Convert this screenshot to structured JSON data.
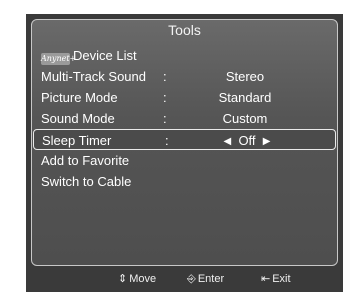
{
  "menu": {
    "title": "Tools",
    "logo_text": "Anynet+",
    "items": [
      {
        "label": "Device List"
      },
      {
        "label": "Multi-Track Sound",
        "separator": ":",
        "value": "Stereo"
      },
      {
        "label": "Picture Mode",
        "separator": ":",
        "value": "Standard"
      },
      {
        "label": "Sound Mode",
        "separator": ":",
        "value": "Custom"
      },
      {
        "label": "Sleep Timer",
        "separator": ":",
        "value": "Off",
        "selected": true
      },
      {
        "label": "Add to Favorite"
      },
      {
        "label": "Switch to Cable"
      }
    ]
  },
  "footer": {
    "move_label": "Move",
    "enter_label": "Enter",
    "exit_label": "Exit"
  },
  "icons": {
    "left_arrow": "left-triangle-icon",
    "right_arrow": "right-triangle-icon",
    "move": "up-down-icon",
    "enter": "enter-icon",
    "exit": "exit-icon"
  },
  "colors": {
    "panel_bg": "#585858",
    "outer_bg": "#3a3a3a",
    "highlight_border": "#eaeaea",
    "text": "#ffffff"
  }
}
